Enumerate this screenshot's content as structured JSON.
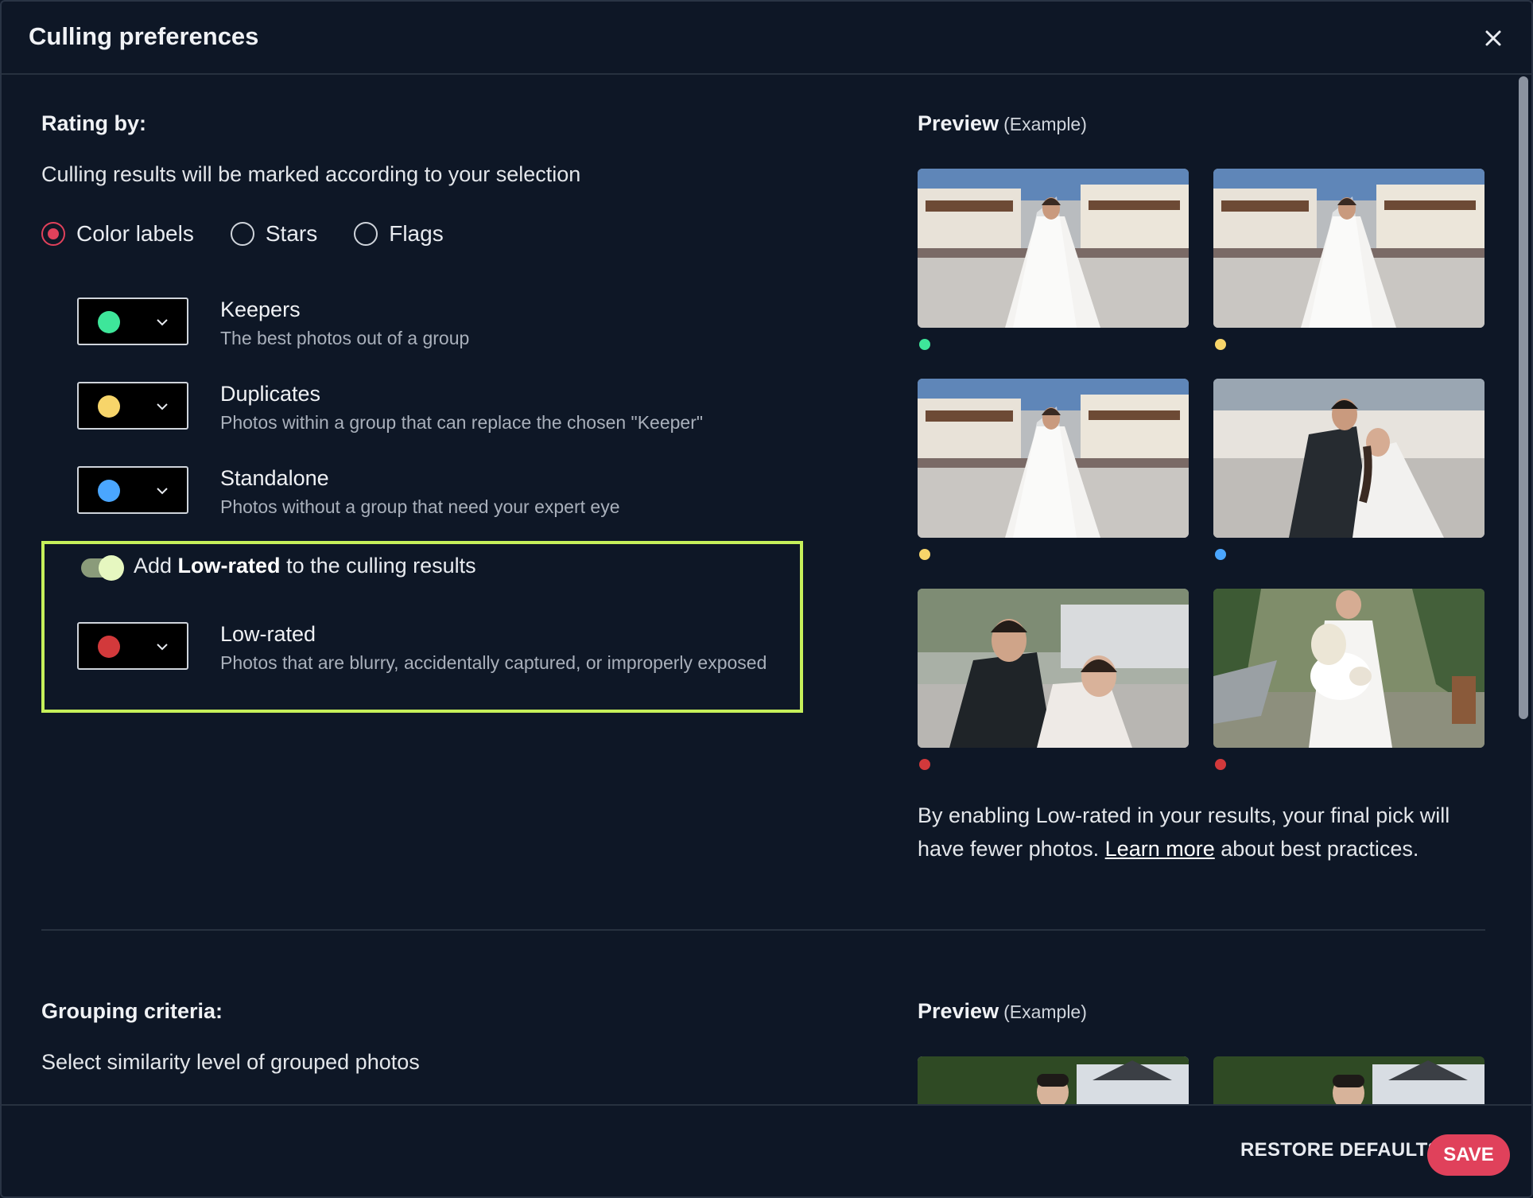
{
  "dialog": {
    "title": "Culling preferences"
  },
  "rating": {
    "heading": "Rating by:",
    "subtitle": "Culling results will be marked according to your selection",
    "options": [
      {
        "label": "Color labels",
        "checked": true
      },
      {
        "label": "Stars",
        "checked": false
      },
      {
        "label": "Flags",
        "checked": false
      }
    ],
    "labels": [
      {
        "title": "Keepers",
        "desc": "The best photos out of a group",
        "color": "#3ee69a"
      },
      {
        "title": "Duplicates",
        "desc": "Photos within a group that can replace the chosen \"Keeper\"",
        "color": "#f7d56a"
      },
      {
        "title": "Standalone",
        "desc": "Photos without a group that need your expert eye",
        "color": "#4aa6ff"
      }
    ],
    "lowrated": {
      "toggle_on": true,
      "toggle_prefix": "Add ",
      "toggle_bold": "Low-rated",
      "toggle_suffix": " to the culling results",
      "title": "Low-rated",
      "desc": "Photos that are blurry, accidentally captured, or improperly exposed",
      "color": "#d2393b"
    }
  },
  "preview": {
    "heading": "Preview",
    "example": "(Example)",
    "thumbs": [
      {
        "scene": "bride-street",
        "dot": "#3ee69a"
      },
      {
        "scene": "bride-street",
        "dot": "#f7d56a"
      },
      {
        "scene": "bride-street",
        "dot": "#f7d56a"
      },
      {
        "scene": "couple-kiss",
        "dot": "#4aa6ff"
      },
      {
        "scene": "couple-blurry",
        "dot": "#d2393b"
      },
      {
        "scene": "bride-bouquet",
        "dot": "#d2393b"
      }
    ],
    "info_before": "By enabling Low-rated in your results, your final pick will have fewer photos. ",
    "info_link": "Learn more",
    "info_after": " about best practices."
  },
  "grouping": {
    "heading": "Grouping criteria:",
    "subtitle": "Select similarity level of grouped photos",
    "preview_heading": "Preview",
    "preview_example": "(Example)"
  },
  "footer": {
    "restore_label": "RESTORE DEFAULTS",
    "save_label": "SAVE"
  }
}
